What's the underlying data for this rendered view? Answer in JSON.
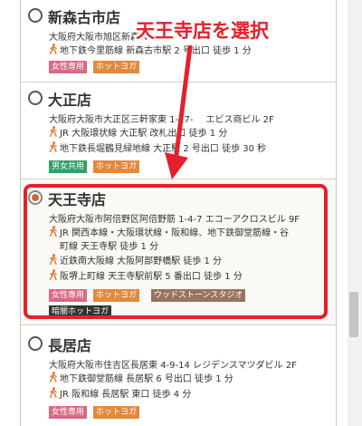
{
  "callout": {
    "text": "天王寺店を選択",
    "color": "#e4202b"
  },
  "stores": [
    {
      "name": "新森古市店",
      "selected": false,
      "address": "大阪府大阪市旭区新森 4-",
      "access": [
        "地下鉄今里筋線 新森古市駅 2 号出口 徒歩 1 分"
      ],
      "tags": [
        {
          "label": "女性専用",
          "kind": "women"
        },
        {
          "label": "ホットヨガ",
          "kind": "hot"
        }
      ]
    },
    {
      "name": "大正店",
      "selected": false,
      "address": "大阪府大阪市大正区三軒家東 1-17-",
      "address_tail": "エビス商ビル 2F",
      "access": [
        "JR 大阪環状線 大正駅 改札出口 徒歩 1 分",
        "地下鉄長堀鶴見緑地線 大正駅 2 号出口 徒歩 30 秒"
      ],
      "tags": [
        {
          "label": "男女共用",
          "kind": "mixed"
        },
        {
          "label": "ホットヨガ",
          "kind": "hot"
        }
      ]
    },
    {
      "name": "天王寺店",
      "selected": true,
      "address": "大阪府大阪市阿倍野区阿倍野筋 1-4-7 エコーアクロスビル 9F",
      "access": [
        "JR 関西本線・大阪環状線・阪和線、地下鉄御堂筋線・谷",
        "町線 天王寺駅 徒歩 1 分",
        "近鉄南大阪線 大阪阿部野橋駅 徒歩 1 分",
        "阪堺上町線 天王寺駅前駅 5 番出口 徒歩 1 分"
      ],
      "tags": [
        {
          "label": "女性専用",
          "kind": "women"
        },
        {
          "label": "ホットヨガ",
          "kind": "hot"
        },
        {
          "label": "ウッドストーンスタジオ",
          "kind": "wood"
        },
        {
          "label": "暗闇ホットヨガ",
          "kind": "dark"
        }
      ]
    },
    {
      "name": "長居店",
      "selected": false,
      "address": "大阪府大阪市住吉区長居東 4-9-14 レジデンスマツダビル 2F",
      "access": [
        "地下鉄御堂筋線 長居駅 6 号出口 徒歩 1 分",
        "JR 阪和線 長居駅 東口 徒歩 4 分"
      ],
      "tags": [
        {
          "label": "女性専用",
          "kind": "women"
        },
        {
          "label": "ホットヨガ",
          "kind": "hot"
        }
      ]
    }
  ]
}
